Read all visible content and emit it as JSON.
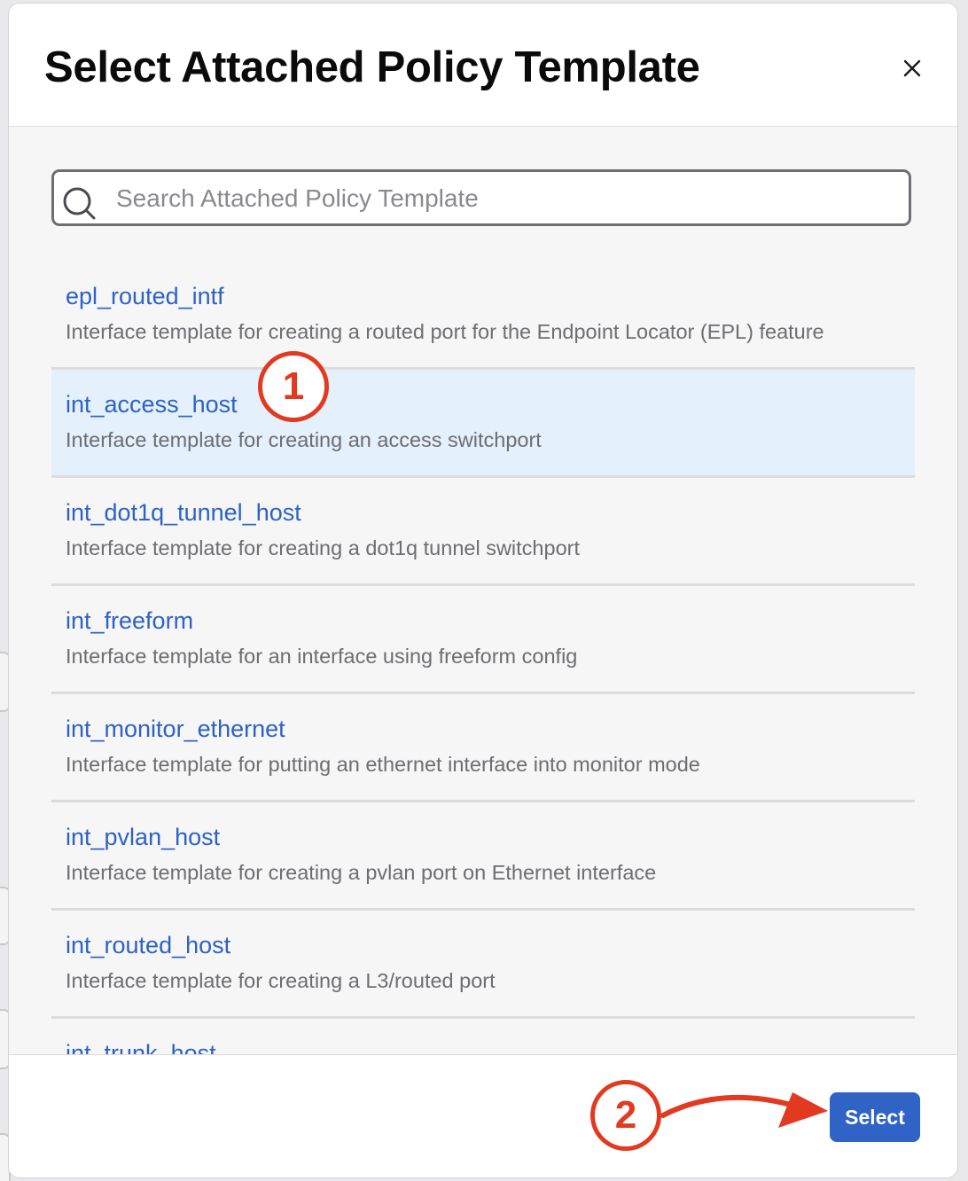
{
  "dialog": {
    "title": "Select Attached Policy Template",
    "close_icon": "close-icon"
  },
  "search": {
    "placeholder": "Search Attached Policy Template",
    "value": "",
    "icon": "search-icon"
  },
  "templates": [
    {
      "name": "epl_routed_intf",
      "description": "Interface template for creating a routed port for the Endpoint Locator (EPL) feature",
      "selected": false
    },
    {
      "name": "int_access_host",
      "description": "Interface template for creating an access switchport",
      "selected": true
    },
    {
      "name": "int_dot1q_tunnel_host",
      "description": "Interface template for creating a dot1q tunnel switchport",
      "selected": false
    },
    {
      "name": "int_freeform",
      "description": "Interface template for an interface using freeform config",
      "selected": false
    },
    {
      "name": "int_monitor_ethernet",
      "description": "Interface template for putting an ethernet interface into monitor mode",
      "selected": false
    },
    {
      "name": "int_pvlan_host",
      "description": "Interface template for creating a pvlan port on Ethernet interface",
      "selected": false
    },
    {
      "name": "int_routed_host",
      "description": "Interface template for creating a L3/routed port",
      "selected": false
    },
    {
      "name": "int_trunk_host",
      "description": "",
      "selected": false
    }
  ],
  "footer": {
    "select_label": "Select"
  },
  "annotations": {
    "step1": "1",
    "step2": "2",
    "color": "#e23a21"
  },
  "colors": {
    "accent": "#2f63c6",
    "link": "#2d62c4",
    "selected_row": "#e4f0fb"
  }
}
